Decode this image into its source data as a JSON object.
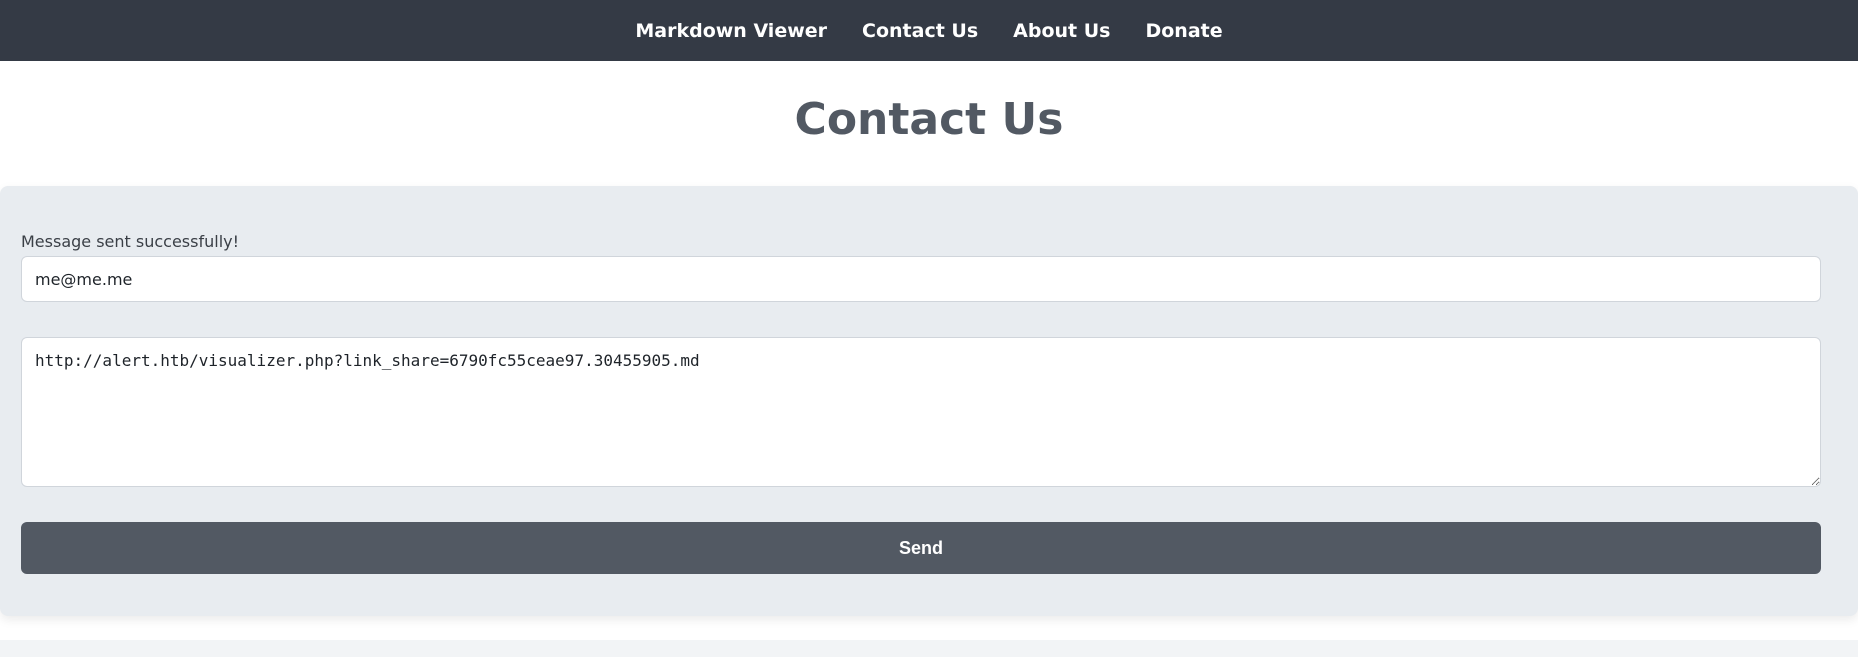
{
  "nav": {
    "items": [
      {
        "label": "Markdown Viewer"
      },
      {
        "label": "Contact Us"
      },
      {
        "label": "About Us"
      },
      {
        "label": "Donate"
      }
    ]
  },
  "page": {
    "title": "Contact Us"
  },
  "form": {
    "status_message": "Message sent successfully!",
    "email_value": "me@me.me",
    "message_value": "http://alert.htb/visualizer.php?link_share=6790fc55ceae97.30455905.md",
    "send_label": "Send"
  },
  "colors": {
    "navbar_bg": "#343a45",
    "card_bg": "#e8ecf0",
    "button_bg": "#525963",
    "title_color": "#525963"
  }
}
